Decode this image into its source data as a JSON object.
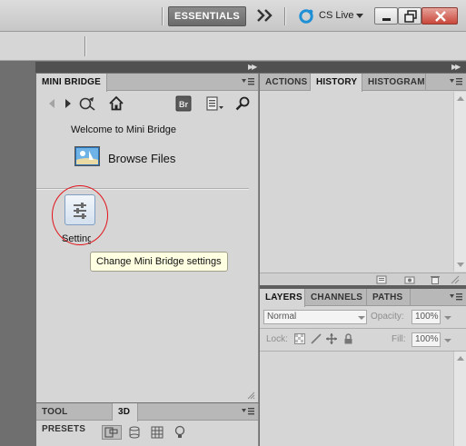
{
  "header": {
    "workspace_button": "ESSENTIALS",
    "more_workspaces_icon": "double-chevron-right-icon",
    "cs_live_label": "CS Live"
  },
  "mini_bridge": {
    "tab": "MINI BRIDGE",
    "welcome": "Welcome to Mini Bridge",
    "browse_files": "Browse Files",
    "settings_label": "Settings",
    "settings_tooltip": "Change Mini Bridge settings",
    "bridge_badge": "Br"
  },
  "history_panel": {
    "tabs": [
      "ACTIONS",
      "HISTORY",
      "HISTOGRAM"
    ],
    "active_tab": "HISTORY"
  },
  "layers_panel": {
    "tabs": [
      "LAYERS",
      "CHANNELS",
      "PATHS"
    ],
    "active_tab": "LAYERS",
    "blend_mode": "Normal",
    "opacity_label": "Opacity:",
    "opacity_value": "100%",
    "lock_label": "Lock:",
    "fill_label": "Fill:",
    "fill_value": "100%"
  },
  "tool_presets_panel": {
    "tabs": [
      "TOOL PRESETS",
      "3D"
    ],
    "active_tab": "3D"
  },
  "colors": {
    "accent_red_annotation": "#e0141a",
    "tooltip_bg": "#ffffe1",
    "panel_bg": "#d6d6d6"
  }
}
